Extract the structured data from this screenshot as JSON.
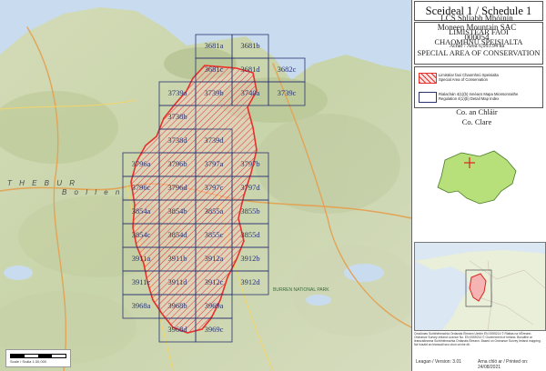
{
  "title": "Sceideal 1 / Schedule 1",
  "designation": {
    "line1": "LIMISTÉAR FAOI",
    "line2": "CHAOMHNÚ SPEISIALTA",
    "line3": "SPECIAL AREA OF CONSERVATION"
  },
  "legend": {
    "sac_irish": "Limistéar faoi Chaomhnú Speisialta",
    "sac_english": "Special Area of Conservation",
    "index_irish": "Rialachán 4(1)(b) Innéacs Mapa Mionsonraithe",
    "index_english": "Regulation 4(1)(b) Detail Map Index"
  },
  "site": {
    "irish_name": "LCS Shliabh Mhóinín",
    "english_name": "Moneen Mountain SAC",
    "code": "000054",
    "area": "Achar / Area 6,093.94 ha"
  },
  "county": {
    "irish": "Co. an Chláir",
    "english": "Co. Clare"
  },
  "map": {
    "place_label_1": "T H E   B U R",
    "place_label_2": "B o l l e n",
    "park_label": "BURREN NATIONAL PARK",
    "scale": "Scale / Scála   1:30,000",
    "tiles": [
      "3681a",
      "3681b",
      "3681c",
      "3681d",
      "3682c",
      "3739a",
      "3739b",
      "3740a",
      "3739c",
      "3738b",
      "3738d",
      "3739d",
      "3796a",
      "3796b",
      "3797a",
      "3797b",
      "3796c",
      "3796d",
      "3797c",
      "3797d",
      "3854a",
      "3854b",
      "3855a",
      "3855b",
      "3854c",
      "3854d",
      "3855c",
      "3855d",
      "3911a",
      "3911b",
      "3912a",
      "3912b",
      "3911c",
      "3911d",
      "3912c",
      "3912d",
      "3968a",
      "3968b",
      "3969a",
      "3968d",
      "3969c"
    ]
  },
  "footer": {
    "notes": "Ceadúnas Suirbhéireachta Ordanáis Éireann Uimhir EN 0059214 © Rialtas na hÉireann. Ordnance Survey Ireland Licence No. EN 0059214 © Government of Ireland. Bunaithe ar léarscáileanna Suirbhéireachta Ordanáis Éireann. Based on Ordnance Survey Ireland mapping. Ná húsáid an léarscáil seo chun críche dlí.",
    "version": "Leagan / Version: 3.01",
    "printed": "Arna chló ar / Printed on: 24/08/2021"
  },
  "colors": {
    "sac_outline": "#e8302a",
    "tile_outline": "#2a3470",
    "sea": "#c9dcef",
    "land": "#cfd9b2"
  }
}
